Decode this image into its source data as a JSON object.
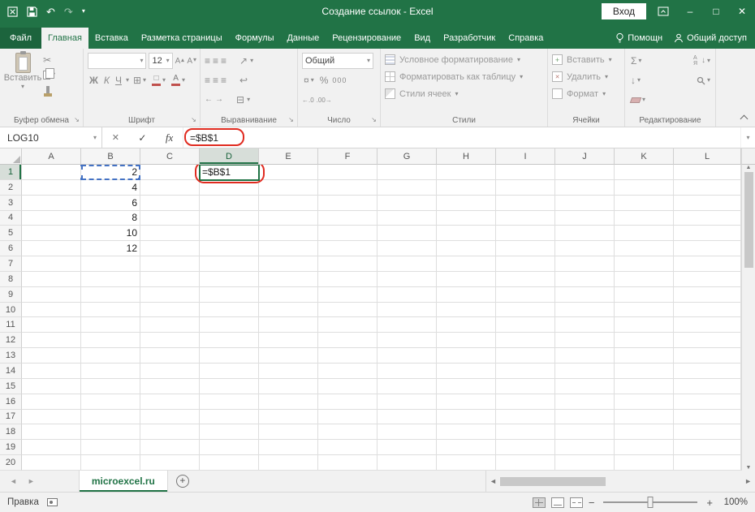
{
  "colors": {
    "excel_green": "#217346",
    "annotation_red": "#e02b20",
    "reference_blue": "#4472c4",
    "ribbon_background": "#f1f1f1"
  },
  "titlebar": {
    "title": "Создание ссылок  -  Excel",
    "sign_in_label": "Вход"
  },
  "ribbon_tabs": {
    "file": "Файл",
    "items": [
      {
        "name": "home",
        "label": "Главная",
        "active": true
      },
      {
        "name": "insert",
        "label": "Вставка"
      },
      {
        "name": "page-layout",
        "label": "Разметка страницы"
      },
      {
        "name": "formulas",
        "label": "Формулы"
      },
      {
        "name": "data",
        "label": "Данные"
      },
      {
        "name": "review",
        "label": "Рецензирование"
      },
      {
        "name": "view",
        "label": "Вид"
      },
      {
        "name": "developer",
        "label": "Разработчик"
      },
      {
        "name": "help",
        "label": "Справка"
      }
    ],
    "assistant_label": "Помощн",
    "share_label": "Общий доступ"
  },
  "ribbon": {
    "clipboard": {
      "group_label": "Буфер обмена",
      "paste_label": "Вставить"
    },
    "font": {
      "group_label": "Шрифт",
      "font_size": "12",
      "bold": "Ж",
      "italic": "К",
      "underline": "Ч",
      "font_color_letter": "А",
      "grow_letter": "А",
      "shrink_letter": "А"
    },
    "alignment": {
      "group_label": "Выравнивание"
    },
    "number": {
      "group_label": "Число",
      "format": "Общий",
      "percent": "%",
      "thousands": "000"
    },
    "styles": {
      "group_label": "Стили",
      "conditional_label": "Условное форматирование",
      "format_table_label": "Форматировать как таблицу",
      "cell_styles_label": "Стили ячеек"
    },
    "cells": {
      "group_label": "Ячейки",
      "insert_label": "Вставить",
      "delete_label": "Удалить",
      "format_label": "Формат"
    },
    "editing": {
      "group_label": "Редактирование",
      "autosum": "Σ",
      "sort_letters": "АЯ"
    }
  },
  "formula_bar": {
    "name_box": "LOG10",
    "formula": "=$B$1",
    "fx_label": "fx",
    "enter_glyph": "✓",
    "cancel_glyph": "✕"
  },
  "grid": {
    "columns": [
      "A",
      "B",
      "C",
      "D",
      "E",
      "F",
      "G",
      "H",
      "I",
      "J",
      "K",
      "L"
    ],
    "row_count": 20,
    "cells": {
      "B1": "2",
      "B2": "4",
      "B3": "6",
      "B4": "8",
      "B5": "10",
      "B6": "12",
      "D1": "=$B$1"
    },
    "active_cell": "D1",
    "reference_cell": "B1",
    "selected_column": "D",
    "selected_row": "1"
  },
  "sheet_bar": {
    "active_sheet": "microexcel.ru"
  },
  "status_bar": {
    "mode_label": "Правка",
    "zoom_level": "100%"
  },
  "icons": {
    "caret": "▾",
    "undo": "↶",
    "redo": "↷",
    "scissors": "✂",
    "borders": "⊞",
    "merge": "⊟",
    "wrap": "↩",
    "orientation": "↗",
    "align_lines": "≡",
    "indent_left": "←",
    "indent_right": "→",
    "currency": "¤",
    "inc_decimal": "←.0",
    "dec_decimal": ".00→",
    "fill_down": "↓",
    "sort_arrow": "↓",
    "left": "◄",
    "right": "►",
    "up": "▲",
    "down": "▼",
    "plus": "+",
    "minus": "−",
    "minimize": "–",
    "maximize": "□",
    "close": "✕"
  }
}
